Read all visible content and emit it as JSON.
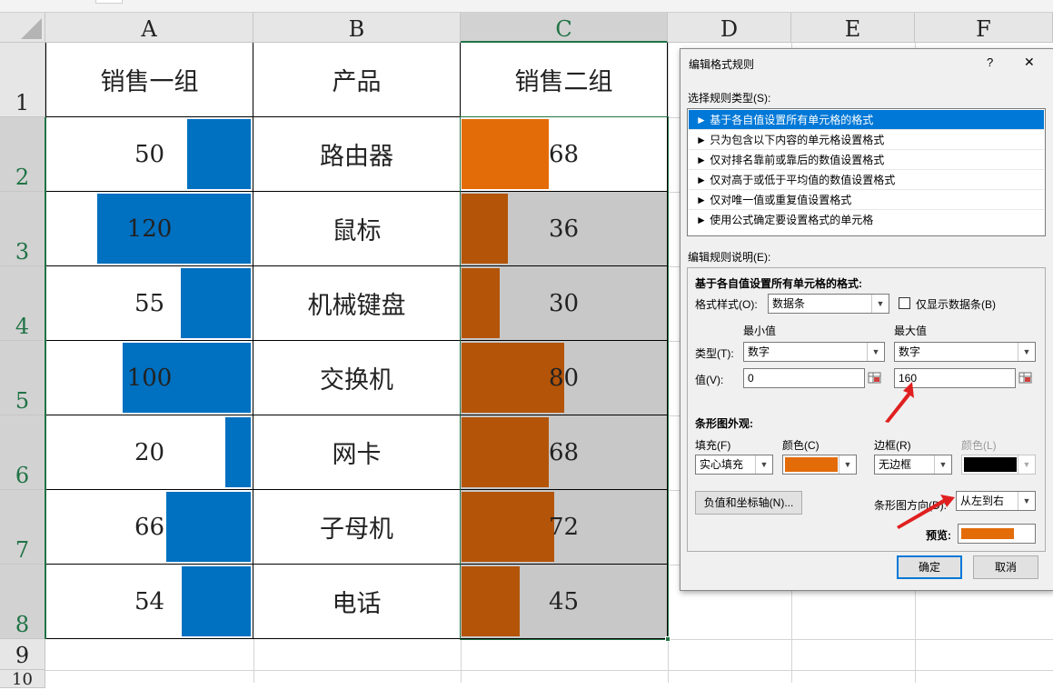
{
  "sheet": {
    "columns": [
      "A",
      "B",
      "C",
      "D",
      "E",
      "F"
    ],
    "rows": [
      "1",
      "2",
      "3",
      "4",
      "5",
      "6",
      "7",
      "8",
      "9",
      "10"
    ],
    "headers": {
      "a": "销售一组",
      "b": "产品",
      "c": "销售二组"
    },
    "records": [
      {
        "a": "50",
        "b": "路由器",
        "c": "68"
      },
      {
        "a": "120",
        "b": "鼠标",
        "c": "36"
      },
      {
        "a": "55",
        "b": "机械键盘",
        "c": "30"
      },
      {
        "a": "100",
        "b": "交换机",
        "c": "80"
      },
      {
        "a": "20",
        "b": "网卡",
        "c": "68"
      },
      {
        "a": "66",
        "b": "子母机",
        "c": "72"
      },
      {
        "a": "54",
        "b": "电话",
        "c": "45"
      }
    ],
    "bar_max_a": 120,
    "bar_max_c": 160,
    "colors": {
      "blue": "#0070c0",
      "orange_preview": "#e36c09",
      "orange_dark": "#b35408",
      "gray_fill": "#c8c8c8",
      "selection_green": "#217346"
    }
  },
  "dialog": {
    "title": "编辑格式规则",
    "help": "?",
    "close": "✕",
    "select_type_label": "选择规则类型(S):",
    "rule_types": [
      "► 基于各自值设置所有单元格的格式",
      "► 只为包含以下内容的单元格设置格式",
      "► 仅对排名靠前或靠后的数值设置格式",
      "► 仅对高于或低于平均值的数值设置格式",
      "► 仅对唯一值或重复值设置格式",
      "► 使用公式确定要设置格式的单元格"
    ],
    "edit_desc_label": "编辑规则说明(E):",
    "desc_heading": "基于各自值设置所有单元格的格式:",
    "format_style_label": "格式样式(O):",
    "format_style_value": "数据条",
    "show_bar_only_label": "仅显示数据条(B)",
    "min_label": "最小值",
    "max_label": "最大值",
    "type_label": "类型(T):",
    "min_type": "数字",
    "max_type": "数字",
    "value_label": "值(V):",
    "min_value": "0",
    "max_value": "160",
    "bar_appearance_label": "条形图外观:",
    "fill_label": "填充(F)",
    "color_label": "颜色(C)",
    "border_label": "边框(R)",
    "border_color_label": "颜色(L)",
    "fill_value": "实心填充",
    "border_value": "无边框",
    "fill_color": "#e36c09",
    "border_color": "#000000",
    "neg_axis_button": "负值和坐标轴(N)...",
    "direction_label": "条形图方向(D):",
    "direction_value": "从左到右",
    "preview_label": "预览:",
    "ok_button": "确定",
    "cancel_button": "取消"
  }
}
